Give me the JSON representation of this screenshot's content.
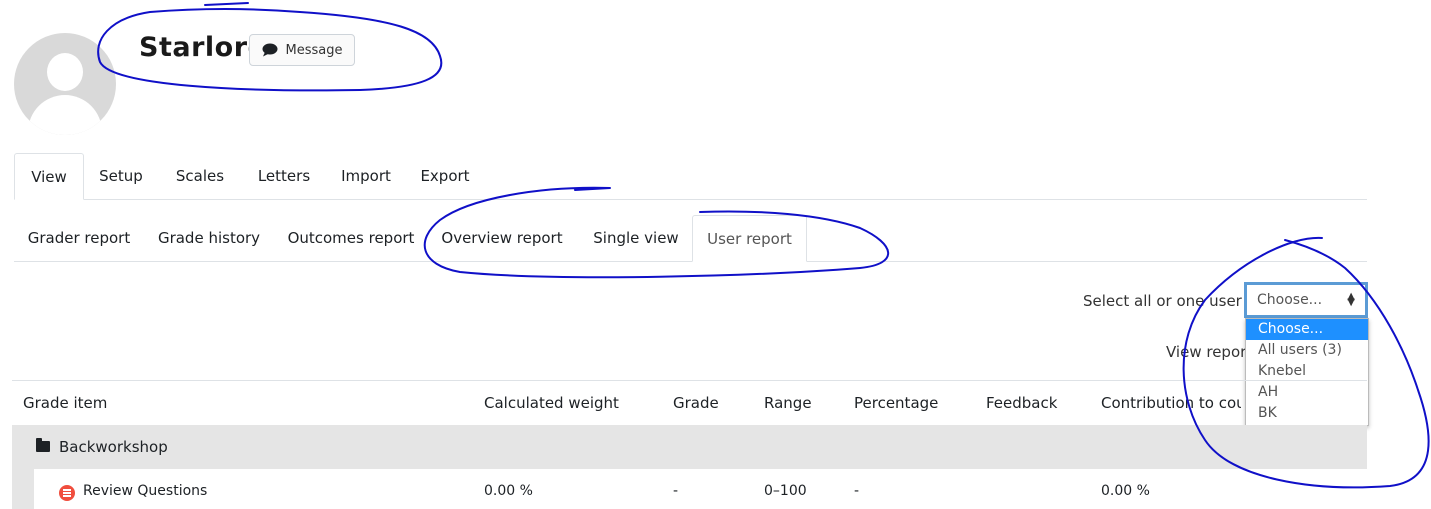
{
  "profile": {
    "name": "Starlord",
    "message_label": "Message"
  },
  "primary_tabs": [
    "View",
    "Setup",
    "Scales",
    "Letters",
    "Import",
    "Export"
  ],
  "secondary_tabs": [
    "Grader report",
    "Grade history",
    "Outcomes report",
    "Overview report",
    "Single view",
    "User report"
  ],
  "user_select": {
    "label": "Select all or one user",
    "value": "Choose...",
    "options": [
      "Choose...",
      "All users (3)",
      "Knebel",
      "AH",
      "BK"
    ]
  },
  "view_label": "View report",
  "table": {
    "headers": [
      "Grade item",
      "Calculated weight",
      "Grade",
      "Range",
      "Percentage",
      "Feedback",
      "Contribution to course total"
    ],
    "category": "Backworkshop",
    "rows": [
      {
        "item": "Review Questions",
        "weight": "0.00 %",
        "grade": "-",
        "range": "0–100",
        "percentage": "-",
        "feedback": "",
        "contribution": "0.00 %"
      }
    ]
  },
  "colors": {
    "selected_option": "#1e90ff",
    "select_focus": "#5b9bd5",
    "annotation_ink": "#1010c8",
    "quiz_icon": "#f04e3e"
  }
}
